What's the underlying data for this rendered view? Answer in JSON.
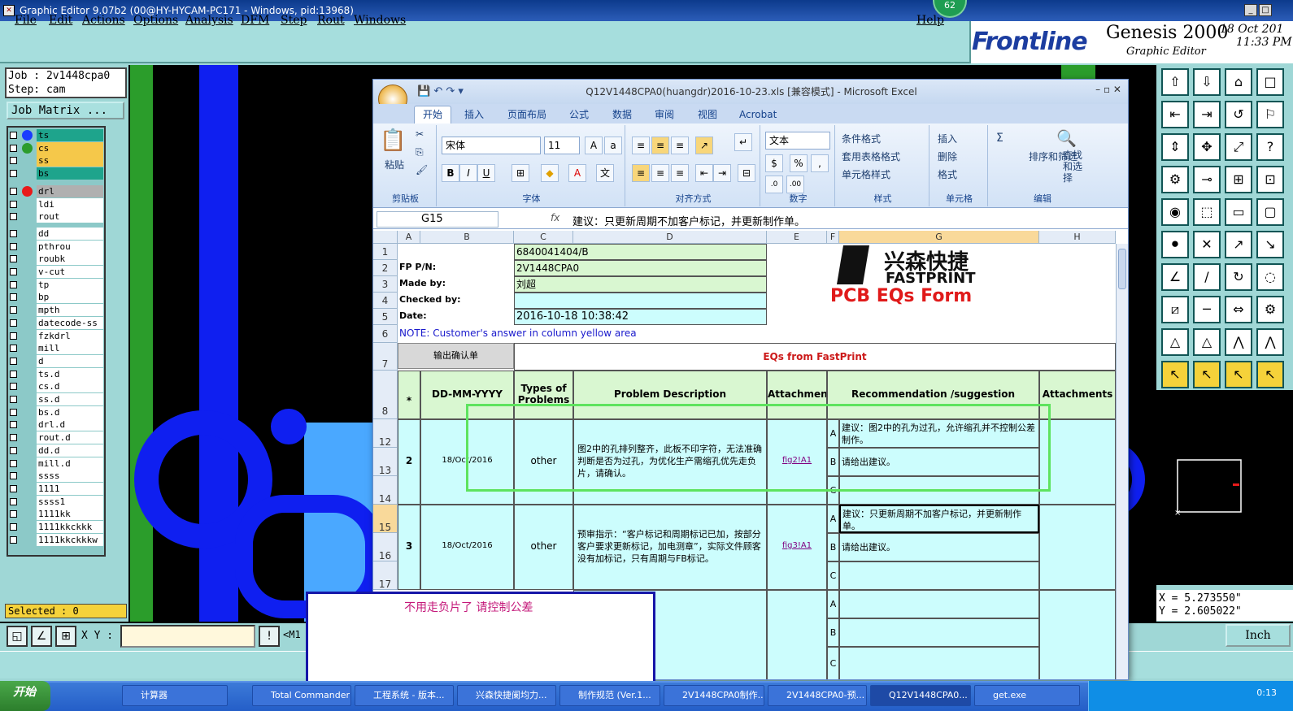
{
  "window_title": "Graphic Editor 9.07b2 (00@HY-HYCAM-PC171 - Windows, pid:13968)",
  "badge_count": "62",
  "menu": [
    "File",
    "Edit",
    "Actions",
    "Options",
    "Analysis",
    "DFM",
    "Step",
    "Rout",
    "Windows"
  ],
  "help": "Help",
  "brand": {
    "logo": "Frontline",
    "product": "Genesis 2000",
    "sub": "Graphic Editor",
    "date": "18 Oct 201",
    "time": "11:33 PM"
  },
  "job_label": "Job : 2v1448cpa0",
  "step_label": "Step: cam",
  "job_matrix": "Job Matrix ...",
  "layers": [
    {
      "name": "ts",
      "color": "#1ea48c",
      "dot": "#1a3cff"
    },
    {
      "name": "cs",
      "color": "#f5c84a",
      "dot": "#2c9c2c"
    },
    {
      "name": "ss",
      "color": "#f5c84a",
      "dot": ""
    },
    {
      "name": "bs",
      "color": "#1ea48c",
      "dot": ""
    },
    {
      "name": "drl",
      "color": "#b0b0b0",
      "dot": "#e81a1a"
    },
    {
      "name": "ldi",
      "color": "#ffffff",
      "dot": ""
    },
    {
      "name": "rout",
      "color": "#ffffff",
      "dot": ""
    },
    {
      "name": "dd",
      "color": "#ffffff",
      "dot": ""
    },
    {
      "name": "pthrou",
      "color": "#ffffff",
      "dot": ""
    },
    {
      "name": "roubk",
      "color": "#ffffff",
      "dot": ""
    },
    {
      "name": "v-cut",
      "color": "#ffffff",
      "dot": ""
    },
    {
      "name": "tp",
      "color": "#ffffff",
      "dot": ""
    },
    {
      "name": "bp",
      "color": "#ffffff",
      "dot": ""
    },
    {
      "name": "mpth",
      "color": "#ffffff",
      "dot": ""
    },
    {
      "name": "datecode-ss",
      "color": "#ffffff",
      "dot": ""
    },
    {
      "name": "fzkdrl",
      "color": "#ffffff",
      "dot": ""
    },
    {
      "name": "mill",
      "color": "#ffffff",
      "dot": ""
    },
    {
      "name": "d",
      "color": "#ffffff",
      "dot": ""
    },
    {
      "name": "ts.d",
      "color": "#ffffff",
      "dot": ""
    },
    {
      "name": "cs.d",
      "color": "#ffffff",
      "dot": ""
    },
    {
      "name": "ss.d",
      "color": "#ffffff",
      "dot": ""
    },
    {
      "name": "bs.d",
      "color": "#ffffff",
      "dot": ""
    },
    {
      "name": "drl.d",
      "color": "#ffffff",
      "dot": ""
    },
    {
      "name": "rout.d",
      "color": "#ffffff",
      "dot": ""
    },
    {
      "name": "dd.d",
      "color": "#ffffff",
      "dot": ""
    },
    {
      "name": "mill.d",
      "color": "#ffffff",
      "dot": ""
    },
    {
      "name": "ssss",
      "color": "#ffffff",
      "dot": ""
    },
    {
      "name": "1111",
      "color": "#ffffff",
      "dot": ""
    },
    {
      "name": "ssss1",
      "color": "#ffffff",
      "dot": ""
    },
    {
      "name": "1111kk",
      "color": "#ffffff",
      "dot": ""
    },
    {
      "name": "1111kkckkk",
      "color": "#ffffff",
      "dot": ""
    },
    {
      "name": "1111kkckkkw",
      "color": "#ffffff",
      "dot": ""
    }
  ],
  "selected_label": "Selected : 0",
  "xy_label": "X Y :",
  "m1_label": "<M1",
  "coords": {
    "x": "X = 5.273550\"",
    "y": "Y = 2.605022\""
  },
  "units_btn": "Inch",
  "excel": {
    "title": "Q12V1448CPA0(huangdr)2016-10-23.xls [兼容模式] - Microsoft Excel",
    "tabs": [
      "开始",
      "插入",
      "页面布局",
      "公式",
      "数据",
      "审阅",
      "视图",
      "Acrobat"
    ],
    "font_name": "宋体",
    "font_size": "11",
    "number_format": "文本",
    "ribbon_labels": {
      "clipboard": "剪贴板",
      "font": "字体",
      "align": "对齐方式",
      "number": "数字",
      "styles": "样式",
      "cells": "单元格",
      "editing": "编辑",
      "paste": "粘贴"
    },
    "ribbon_items": {
      "cond": "条件格式",
      "table": "套用表格格式",
      "cellstyle": "单元格样式",
      "insert": "插入",
      "delete": "删除",
      "format": "格式",
      "sort": "排序和筛选",
      "find": "查找和选择",
      "pct": "%"
    },
    "cell_ref": "G15",
    "fx": "fx",
    "formula": "建议：只更新周期不加客户标记，并更新制作单。",
    "columns": [
      "A",
      "B",
      "C",
      "D",
      "E",
      "F",
      "G",
      "H"
    ],
    "header": {
      "r1_c": "6840041404/B",
      "fp_label": "FP P/N:",
      "fp_value": "2V1448CPA0",
      "made_label": "Made by:",
      "made_value": "刘超",
      "checked_label": "Checked by:",
      "date_label": "Date:",
      "date_value": "2016-10-18 10:38:42",
      "note": "NOTE: Customer's  answer in column yellow area",
      "brand_cn": "兴森快捷",
      "brand_en": "FASTPRINT",
      "form_title": "PCB EQs Form",
      "export_btn": "输出确认单",
      "eqs_title": "EQs from FastPrint"
    },
    "table_headers": [
      "*",
      "DD-MM-YYYY",
      "Types of Problems",
      "Problem Description",
      "Attachment",
      "Recommendation /suggestion",
      "Attachments"
    ],
    "row_numbers": [
      "1",
      "2",
      "3",
      "4",
      "5",
      "6",
      "7",
      "8",
      "12",
      "13",
      "14",
      "15",
      "16",
      "17"
    ],
    "rows": [
      {
        "no": "2",
        "date": "18/Oct/2016",
        "type": "other",
        "desc": "图2中的孔排列整齐，此板不印字符，无法准确判断是否为过孔，为优化生产需缩孔优先走负片，请确认。",
        "attach": "fig2!A1",
        "opt_a": "建议：图2中的孔为过孔，允许缩孔并不控制公差制作。",
        "opt_b": "请给出建议。",
        "opt_c": ""
      },
      {
        "no": "3",
        "date": "18/Oct/2016",
        "type": "other",
        "desc": "预审指示：“客户标记和周期标记已加，按部分客户要求更新标记，加电测章”，实际文件顾客没有加标记，只有周期与FB标记。",
        "attach": "fig3!A1",
        "opt_a": "建议：只更新周期不加客户标记，并更新制作单。",
        "opt_b": "请给出建议。",
        "opt_c": ""
      }
    ],
    "letters": [
      "A",
      "B",
      "C"
    ]
  },
  "annotation": "不用走负片了   请控制公差",
  "taskbar": {
    "start": "开始",
    "items": [
      "计算器",
      "Total Commander ...",
      "工程系统 - 版本...",
      "兴森快捷阑均力...",
      "制作规范 (Ver.1...",
      "2V1448CPA0制作...",
      "2V1448CPA0-预...",
      "Q12V1448CPA0...",
      "get.exe"
    ],
    "time": "0:13"
  }
}
